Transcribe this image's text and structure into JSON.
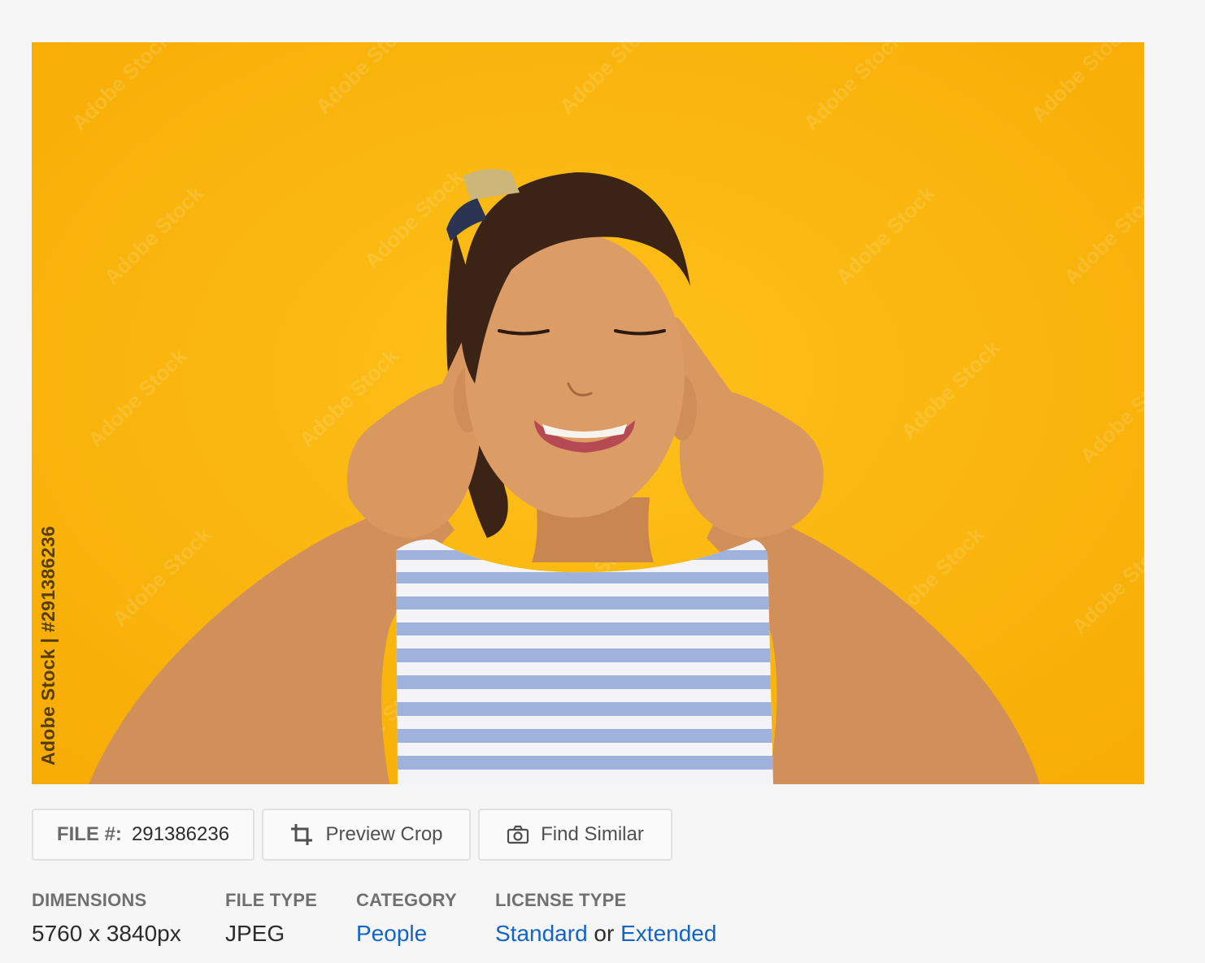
{
  "preview": {
    "watermark_text": "Adobe Stock",
    "side_watermark": "Adobe Stock | #291386236",
    "colors": {
      "background": "#fbb80a",
      "skin": "#d99a64",
      "hair": "#3b2415",
      "stripe_blue": "#9fb2dc",
      "stripe_white": "#f4f4f6"
    }
  },
  "actions": {
    "file_label": "FILE #:",
    "file_number": "291386236",
    "preview_crop": "Preview Crop",
    "find_similar": "Find Similar",
    "icons": [
      "crop-icon",
      "camera-icon"
    ]
  },
  "details": {
    "dimensions_label": "DIMENSIONS",
    "dimensions_value": "5760 x 3840px",
    "file_type_label": "FILE TYPE",
    "file_type_value": "JPEG",
    "category_label": "CATEGORY",
    "category_value": "People",
    "license_label": "LICENSE TYPE",
    "license_standard": "Standard",
    "license_or": "or",
    "license_extended": "Extended",
    "link_color": "#1464c8"
  }
}
